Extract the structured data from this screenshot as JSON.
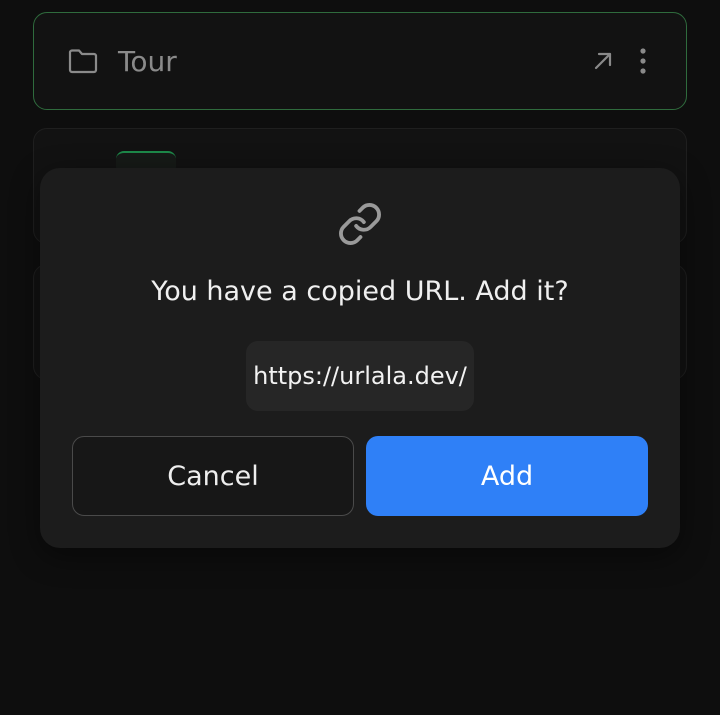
{
  "list": {
    "items": [
      {
        "title": "Tour",
        "icon": "folder-icon"
      },
      {
        "title": "",
        "icon": ""
      },
      {
        "title": "",
        "icon": ""
      }
    ]
  },
  "dialog": {
    "icon": "link-icon",
    "message": "You have a copied URL. Add it?",
    "url": "https://urlala.dev/",
    "cancel_label": "Cancel",
    "add_label": "Add"
  },
  "colors": {
    "background": "#0e0e0e",
    "dialog": "#1c1c1c",
    "primary": "#2f80f7",
    "active_border": "#2f6b3d"
  }
}
